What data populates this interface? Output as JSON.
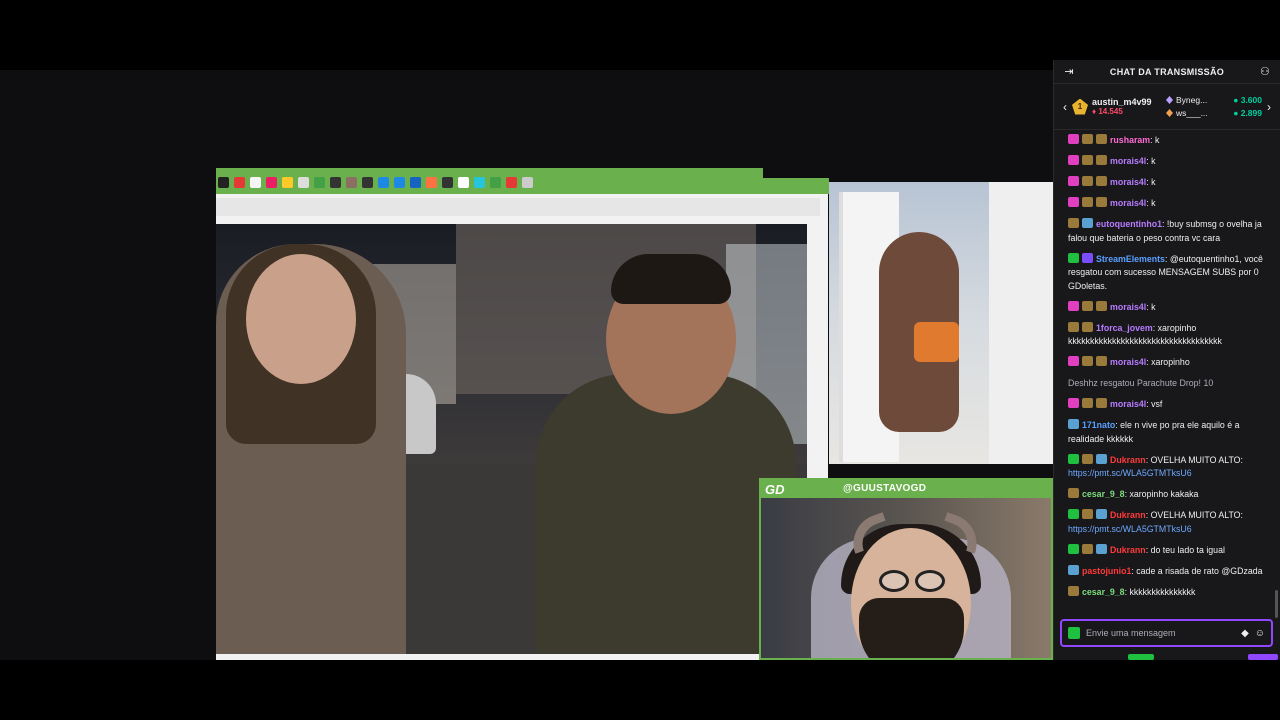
{
  "chat": {
    "title": "CHAT DA TRANSMISSÃO",
    "collapse_icon": "collapse-arrow-icon",
    "users_icon": "community-users-icon",
    "leaderboard": {
      "top_rank": "1",
      "top_user": "austin_m4v99",
      "top_bits": "14.545",
      "entries": [
        {
          "name": "Byneg...",
          "value": "3.600"
        },
        {
          "name": "ws___...",
          "value": "2.899"
        }
      ]
    },
    "input_placeholder": "Envie uma mensagem",
    "messages": [
      {
        "user": "rusharam",
        "color": "#ff6ad5",
        "badges": [
          "heart",
          "sub",
          "sub"
        ],
        "text": ": k"
      },
      {
        "user": "morais4l",
        "color": "#b77cff",
        "badges": [
          "heart",
          "sub",
          "sub"
        ],
        "text": ": k"
      },
      {
        "user": "morais4l",
        "color": "#b77cff",
        "badges": [
          "heart",
          "sub",
          "sub"
        ],
        "text": ": k"
      },
      {
        "user": "morais4l",
        "color": "#b77cff",
        "badges": [
          "heart",
          "sub",
          "sub"
        ],
        "text": ": k"
      },
      {
        "user": "eutoquentinho1",
        "color": "#b77cff",
        "badges": [
          "sub",
          "wave"
        ],
        "text": ": !buy submsg o ovelha ja falou que bateria o peso contra vc cara"
      },
      {
        "user": "StreamElements",
        "color": "#5aa0ff",
        "badges": [
          "ver",
          "stream"
        ],
        "text": ": @eutoquentinho1, você resgatou com sucesso MENSAGEM SUBS por 0 GDoletas."
      },
      {
        "user": "morais4l",
        "color": "#b77cff",
        "badges": [
          "heart",
          "sub",
          "sub"
        ],
        "text": ": k"
      },
      {
        "user": "1forca_jovem",
        "color": "#b77cff",
        "badges": [
          "sub",
          "sub"
        ],
        "text": ": xaropinho kkkkkkkkkkkkkkkkkkkkkkkkkkkkkkkkkkk"
      },
      {
        "user": "morais4l",
        "color": "#b77cff",
        "badges": [
          "heart",
          "sub",
          "sub"
        ],
        "text": ": xaropinho"
      },
      {
        "user": "",
        "color": "#adadb8",
        "badges": [],
        "text": "Deshhz resgatou Parachute Drop! 10"
      },
      {
        "user": "morais4l",
        "color": "#b77cff",
        "badges": [
          "heart",
          "sub",
          "sub"
        ],
        "text": ": vsf"
      },
      {
        "user": "171nato",
        "color": "#5aa0ff",
        "badges": [
          "wave"
        ],
        "text": ": ele n vive po pra ele aquilo é a realidade kkkkkk"
      },
      {
        "user": "Dukrann",
        "color": "#ff3a3a",
        "badges": [
          "ver",
          "sub",
          "wave"
        ],
        "text": ": OVELHA MUITO ALTO: ",
        "link": "https://pmt.sc/WLA5GTMTksU6"
      },
      {
        "user": "cesar_9_8",
        "color": "#7cdc7c",
        "badges": [
          "sub"
        ],
        "text": ": xaropinho kakaka"
      },
      {
        "user": "Dukrann",
        "color": "#ff3a3a",
        "badges": [
          "ver",
          "sub",
          "wave"
        ],
        "text": ": OVELHA MUITO ALTO: ",
        "link": "https://pmt.sc/WLA5GTMTksU6"
      },
      {
        "user": "Dukrann",
        "color": "#ff3a3a",
        "badges": [
          "ver",
          "sub",
          "wave"
        ],
        "text": ": do teu lado ta igual"
      },
      {
        "user": "pastojunio1",
        "color": "#ff3a3a",
        "badges": [
          "wave"
        ],
        "text": ": cade a risada de rato @GDzada"
      },
      {
        "user": "cesar_9_8",
        "color": "#7cdc7c",
        "badges": [
          "sub"
        ],
        "text": ": kkkkkkkkkkkkkkk"
      }
    ]
  },
  "stream": {
    "cam_logo": "GD",
    "cam_handle": "@GUUSTAVOGD"
  },
  "colors": {
    "accent": "#9147ff",
    "overlay_green": "#6ab04c",
    "chat_bg": "#18181b"
  }
}
